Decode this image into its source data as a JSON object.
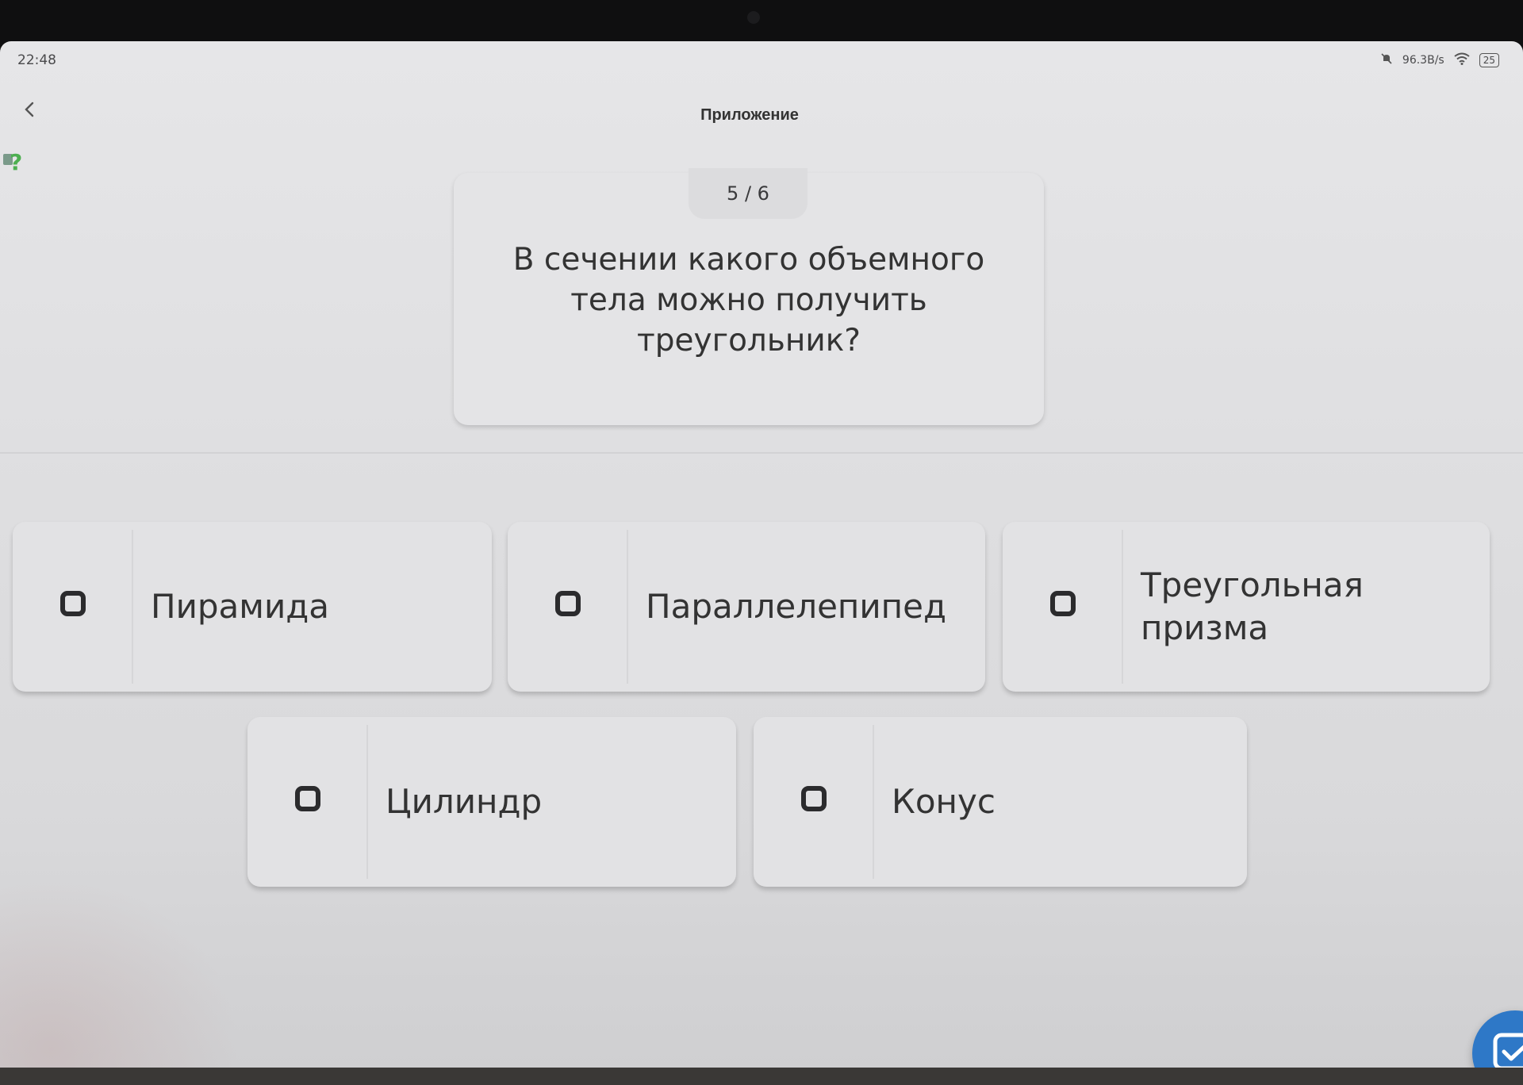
{
  "status_bar": {
    "time": "22:48",
    "network_speed": "96.3B/s",
    "battery": "25",
    "icons": [
      "mute-bell-icon",
      "wifi-icon",
      "battery-icon"
    ]
  },
  "header": {
    "title": "Приложение",
    "back_icon": "chevron-left-icon",
    "help_icon": "question-mark-icon"
  },
  "question": {
    "counter": "5 / 6",
    "text": "В сечении какого объемного тела можно получить треугольник?"
  },
  "answers": [
    {
      "label": "Пирамида",
      "checked": false
    },
    {
      "label": "Параллелепипед",
      "checked": false
    },
    {
      "label": "Треугольная призма",
      "checked": false
    },
    {
      "label": "Цилиндр",
      "checked": false
    },
    {
      "label": "Конус",
      "checked": false
    }
  ],
  "submit": {
    "icon": "checkmark-square-icon"
  },
  "colors": {
    "accent": "#2e78c7",
    "help_icon": "#4caf50",
    "card": "#e2e2e4",
    "text": "#333333"
  }
}
